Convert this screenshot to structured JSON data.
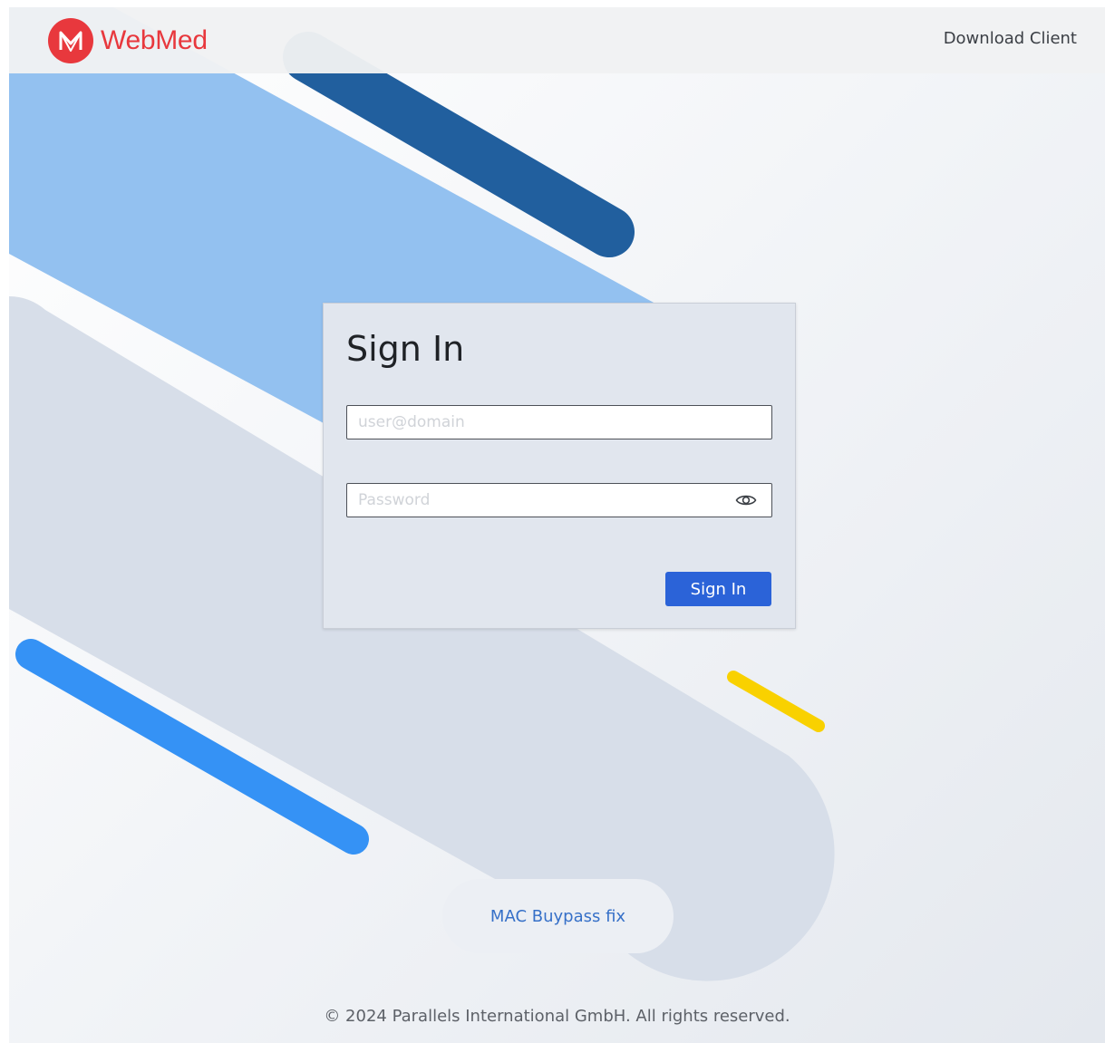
{
  "header": {
    "brand": "WebMed",
    "download_label": "Download Client"
  },
  "signin": {
    "title": "Sign In",
    "username_placeholder": "user@domain",
    "password_placeholder": "Password",
    "button_label": "Sign In"
  },
  "links": {
    "mac_fix": "MAC Buypass fix"
  },
  "footer": {
    "copyright": "© 2024 Parallels International GmbH. All rights reserved."
  },
  "colors": {
    "brand_red": "#e8383d",
    "primary_button": "#2b63d8",
    "link_blue": "#3670c8",
    "stripe_light_blue": "#93c1f0",
    "stripe_dark_blue": "#215f9e",
    "stripe_bright_blue": "#3592f5",
    "stripe_yellow": "#f9d100"
  }
}
